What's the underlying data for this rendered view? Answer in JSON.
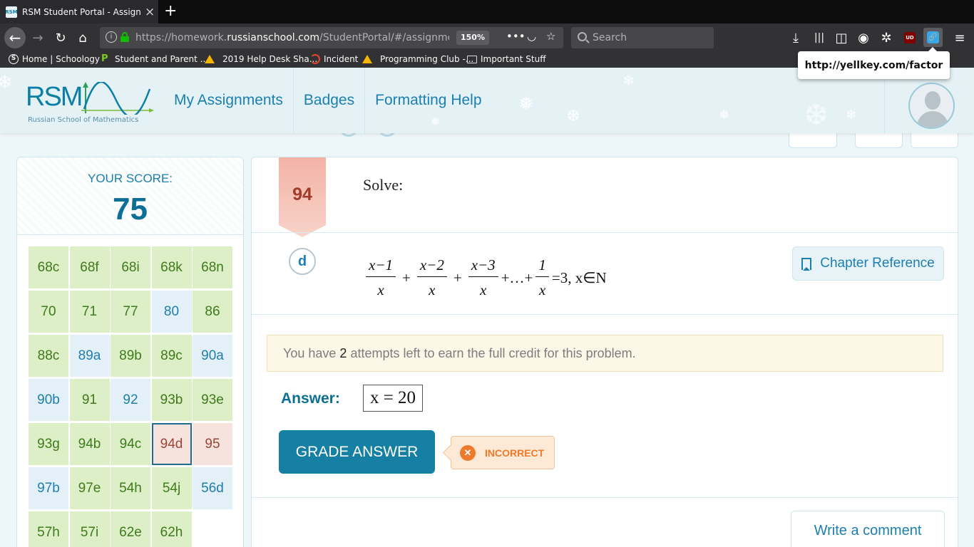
{
  "browser": {
    "tab_title": "RSM Student Portal - Assignme",
    "favicon_text": "RSM",
    "url_prefix": "https://homework.",
    "url_domain": "russianschool.com",
    "url_suffix": "/StudentPortal/#/assignmen",
    "zoom": "150%",
    "search_placeholder": "Search",
    "ublock_label": "UD",
    "bookmarks": [
      {
        "label": "Home | Schoology",
        "icon": "schoology-icon"
      },
      {
        "label": "Student and Parent ...",
        "icon": "p-icon"
      },
      {
        "label": "2019 Help Desk Sha...",
        "icon": "google-drive-icon"
      },
      {
        "label": "Incident",
        "icon": "incident-icon"
      },
      {
        "label": "Programming Club -...",
        "icon": "google-drive-icon"
      },
      {
        "label": "Important Stuff",
        "icon": "folder-icon"
      }
    ],
    "tooltip": "http://yellkey.com/factor"
  },
  "header": {
    "logo_text": "RSM",
    "logo_subtitle": "Russian School of Mathematics",
    "nav": [
      {
        "label": "My Assignments"
      },
      {
        "label": "Badges"
      },
      {
        "label": "Formatting Help"
      }
    ]
  },
  "score": {
    "label": "YOUR SCORE:",
    "value": "75"
  },
  "problems": [
    {
      "label": "68c",
      "status": "green"
    },
    {
      "label": "68f",
      "status": "green"
    },
    {
      "label": "68i",
      "status": "green"
    },
    {
      "label": "68k",
      "status": "green"
    },
    {
      "label": "68n",
      "status": "green"
    },
    {
      "label": "70",
      "status": "green"
    },
    {
      "label": "71",
      "status": "green"
    },
    {
      "label": "77",
      "status": "green"
    },
    {
      "label": "80",
      "status": "blue"
    },
    {
      "label": "86",
      "status": "green"
    },
    {
      "label": "88c",
      "status": "green"
    },
    {
      "label": "89a",
      "status": "blue"
    },
    {
      "label": "89b",
      "status": "green"
    },
    {
      "label": "89c",
      "status": "green"
    },
    {
      "label": "90a",
      "status": "blue"
    },
    {
      "label": "90b",
      "status": "blue"
    },
    {
      "label": "91",
      "status": "green"
    },
    {
      "label": "92",
      "status": "blue"
    },
    {
      "label": "93b",
      "status": "green"
    },
    {
      "label": "93e",
      "status": "green"
    },
    {
      "label": "93g",
      "status": "green"
    },
    {
      "label": "94b",
      "status": "green"
    },
    {
      "label": "94c",
      "status": "green"
    },
    {
      "label": "94d",
      "status": "current"
    },
    {
      "label": "95",
      "status": "red"
    },
    {
      "label": "97b",
      "status": "blue"
    },
    {
      "label": "97e",
      "status": "green"
    },
    {
      "label": "54h",
      "status": "green"
    },
    {
      "label": "54j",
      "status": "green"
    },
    {
      "label": "56d",
      "status": "blue"
    },
    {
      "label": "57h",
      "status": "green"
    },
    {
      "label": "57i",
      "status": "green"
    },
    {
      "label": "62e",
      "status": "green"
    },
    {
      "label": "62h",
      "status": "green"
    }
  ],
  "problem": {
    "number": "94",
    "prompt": "Solve:",
    "part": "d",
    "equation": {
      "f1_num": "x−1",
      "f1_den": "x",
      "f2_num": "x−2",
      "f2_den": "x",
      "f3_num": "x−3",
      "f3_den": "x",
      "f4_num": "1",
      "f4_den": "x",
      "plus": "+",
      "ellipsis": "+…+",
      "tail": "=3, x∈N"
    },
    "chapter_reference": "Chapter Reference",
    "attempts_prefix": "You have",
    "attempts_count": "2",
    "attempts_suffix": "attempts left to earn the full credit for this problem.",
    "answer_label": "Answer:",
    "answer_value": "x = 20",
    "grade_button": "GRADE ANSWER",
    "result": "INCORRECT",
    "comment_button": "Write a comment"
  }
}
